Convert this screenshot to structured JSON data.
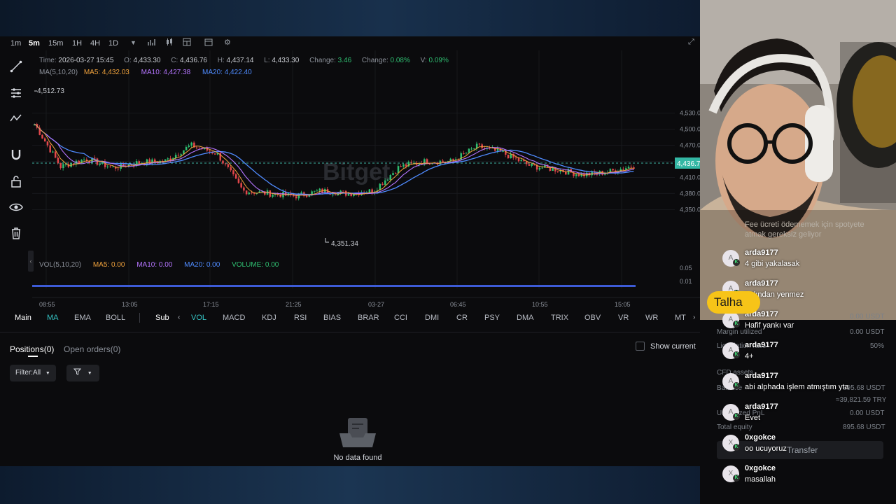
{
  "toolbar": {
    "timeframes": [
      "1m",
      "5m",
      "15m",
      "1H",
      "4H",
      "1D"
    ],
    "active_timeframe": "5m"
  },
  "chart": {
    "info": {
      "time_label": "Time:",
      "time": "2026-03-27 15:45",
      "o_label": "O:",
      "open": "4,433.30",
      "c_label": "C:",
      "close": "4,436.76",
      "h_label": "H:",
      "high": "4,437.14",
      "l_label": "L:",
      "low": "4,433.30",
      "change_label": "Change:",
      "change": "3.46",
      "change_pct_label": "Change:",
      "change_pct": "0.08%",
      "v_label": "V:",
      "v": "0.09%"
    },
    "ma_line": {
      "label": "MA(5,10,20)",
      "ma5": "MA5: 4,432.03",
      "ma10": "MA10: 4,427.38",
      "ma20": "MA20: 4,422.40"
    },
    "vol_line": {
      "label": "VOL(5,10,20)",
      "ma5": "MA5: 0.00",
      "ma10": "MA10: 0.00",
      "ma20": "MA20: 0.00",
      "volume": "VOLUME: 0.00"
    },
    "price_ticks": [
      "4,530.00",
      "4,500.00",
      "4,470.00",
      "4,440.00",
      "4,410.00",
      "4,380.00",
      "4,350.00"
    ],
    "vol_ticks": [
      "0.05",
      "0.01"
    ],
    "time_ticks": [
      "08:55",
      "13:05",
      "17:15",
      "21:25",
      "03-27",
      "06:45",
      "10:55",
      "15:05"
    ],
    "last_price": "4,436.7",
    "max_label": "4,512.73",
    "min_label": "4,351.34",
    "watermark": "Bitget",
    "colors": {
      "up": "#2fbf71",
      "down": "#e2474b",
      "ma5": "#f0a23c",
      "ma10": "#b575ff",
      "ma20": "#4f8bff"
    }
  },
  "chart_data": {
    "type": "line",
    "x": [
      "08:55",
      "10:10",
      "11:50",
      "13:05",
      "14:30",
      "16:00",
      "17:15",
      "18:30",
      "19:45",
      "21:25",
      "22:50",
      "00:10",
      "01:30",
      "03-27",
      "03:50",
      "05:30",
      "06:45",
      "08:00",
      "09:10",
      "10:55",
      "12:15",
      "13:30",
      "15:05",
      "15:45"
    ],
    "series": [
      {
        "name": "MA5",
        "values": [
          4510,
          4430,
          4445,
          4428,
          4438,
          4440,
          4470,
          4455,
          4385,
          4380,
          4375,
          4385,
          4380,
          4385,
          4430,
          4440,
          4440,
          4468,
          4455,
          4432,
          4425,
          4415,
          4420,
          4432
        ]
      }
    ],
    "ylim": [
      4340,
      4540
    ]
  },
  "indicators": {
    "main_label": "Main",
    "main": [
      "MA",
      "EMA",
      "BOLL"
    ],
    "sub_label": "Sub",
    "sub": [
      "VOL",
      "MACD",
      "KDJ",
      "RSI",
      "BIAS",
      "BRAR",
      "CCI",
      "DMI",
      "CR",
      "PSY",
      "DMA",
      "TRIX",
      "OBV",
      "VR",
      "WR",
      "MT"
    ]
  },
  "positions": {
    "tab_positions": "Positions(0)",
    "tab_orders": "Open orders(0)",
    "show_current": "Show current",
    "filter_all": "Filter:All",
    "no_data": "No data found"
  },
  "overlay_ghost": {
    "margin_utilized": "Margin utilized",
    "margin_val": "0.00 USDT",
    "liq_label": "Liquidation ratio",
    "liq_val": "50%",
    "cfd_assets": "CFD assets",
    "balance": "Balance",
    "balance_val": "895.68 USDT",
    "try_val": "≈39,821.59 TRY",
    "unrealized": "Unrealized PnL",
    "unrealized_val": "0.00 USDT",
    "equity": "Total equity",
    "equity_val": "895.68 USDT",
    "transfer": "Transfer",
    "top_usdt": "0.00 USDT"
  },
  "stream": {
    "host_tag": "Talha",
    "faded_comment": "Fee ücreti ödememek için spotyete atmak gereksiz geliyor",
    "comments": [
      {
        "avatar": "A",
        "user": "arda9177",
        "msg": "4 gibi yakalasak"
      },
      {
        "avatar": "A",
        "user": "arda9177",
        "msg": "tadından yenmez"
      },
      {
        "avatar": "A",
        "user": "arda9177",
        "msg": "Hafif yankı var"
      },
      {
        "avatar": "A",
        "user": "arda9177",
        "msg": "4+"
      },
      {
        "avatar": "A",
        "user": "arda9177",
        "msg": "abi alphada işlem atmıştım yta"
      },
      {
        "avatar": "A",
        "user": "arda9177",
        "msg": "Evet"
      },
      {
        "avatar": "X",
        "user": "0xgokce",
        "msg": "oo ucuyoruz"
      },
      {
        "avatar": "X",
        "user": "0xgokce",
        "msg": "masallah"
      }
    ]
  }
}
